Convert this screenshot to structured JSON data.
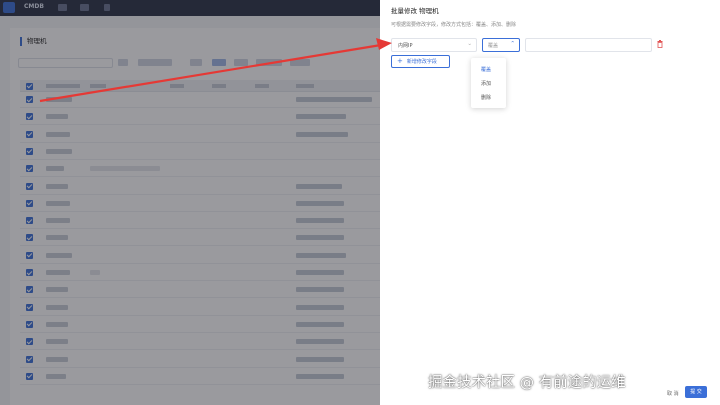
{
  "bg": {
    "app_logo": "CMDB",
    "page_title": "物理机",
    "table_rows": 17
  },
  "drawer": {
    "title": "批量修改 物理机",
    "tip": "可根据需要修改字段，修改方式包括：覆盖、添加、删除",
    "field_select": {
      "value": "内网IP",
      "icon": "chevron-down-icon"
    },
    "action_select": {
      "placeholder": "覆盖",
      "icon": "chevron-down-icon"
    },
    "value_input": {
      "value": ""
    },
    "delete_icon": "trash-icon",
    "add_button": "新增修改字段",
    "dropdown_options": [
      "覆盖",
      "添加",
      "删除"
    ],
    "cancel": "取 消",
    "confirm": "提 交"
  },
  "watermark": "掘金技术社区 @ 有前途的运维",
  "colors": {
    "accent": "#3b6fd8",
    "danger": "#e25353",
    "arrow": "#e53935",
    "topbar": "#2b3245"
  }
}
